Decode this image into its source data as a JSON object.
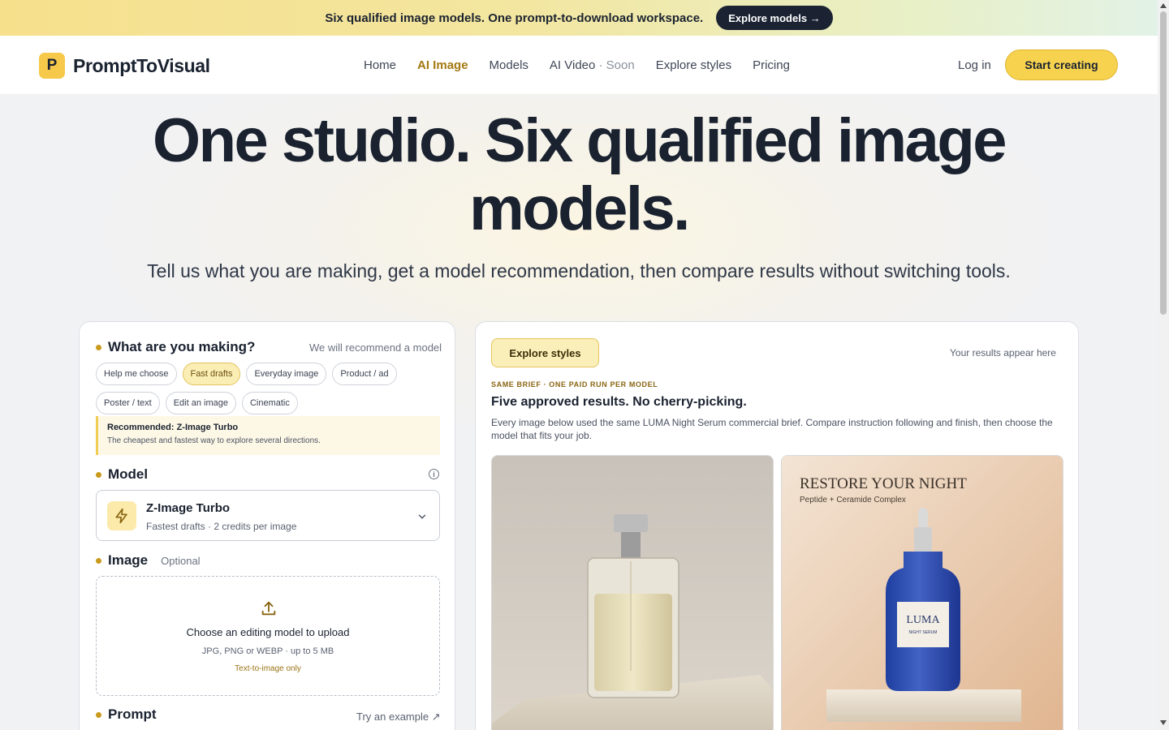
{
  "announcement": {
    "text": "Six qualified image models. One prompt-to-download workspace.",
    "cta_label": "Explore models →"
  },
  "header": {
    "logo_mark": "P",
    "logo_text": "PromptToVisual",
    "nav": [
      {
        "label": "Home",
        "active": false
      },
      {
        "label": "AI Image",
        "active": true
      },
      {
        "label": "Models",
        "active": false
      },
      {
        "label": "AI Video",
        "suffix": " · Soon",
        "active": false
      },
      {
        "label": "Explore styles",
        "active": false
      },
      {
        "label": "Pricing",
        "active": false
      }
    ],
    "login_label": "Log in",
    "start_label": "Start creating"
  },
  "hero": {
    "title": "One studio. Six qualified image models.",
    "subtitle": "Tell us what you are making, get a model recommendation, then compare results without switching tools."
  },
  "composer": {
    "making_title": "What are you making?",
    "making_aux": "We will recommend a model",
    "chips": [
      "Help me choose",
      "Fast drafts",
      "Everyday image",
      "Product / ad",
      "Poster / text",
      "Edit an image",
      "Cinematic"
    ],
    "active_chip": "Fast drafts",
    "recommendation_title": "Recommended: Z-Image Turbo",
    "recommendation_desc": "The cheapest and fastest way to explore several directions.",
    "model_title": "Model",
    "model_name": "Z-Image Turbo",
    "model_desc": "Fastest drafts · 2 credits per image",
    "image_title": "Image",
    "image_aux": "Optional",
    "drop_title": "Choose an editing model to upload",
    "drop_types": "JPG, PNG or WEBP · up to 5 MB",
    "drop_note": "Text-to-image only",
    "prompt_title": "Prompt",
    "try_example": "Try an example ↗"
  },
  "results": {
    "explore_label": "Explore styles",
    "hint": "Your results appear here",
    "kicker": "SAME BRIEF · ONE PAID RUN PER MODEL",
    "title": "Five approved results. No cherry-picking.",
    "desc": "Every image below used the same LUMA Night Serum commercial brief. Compare instruction following and finish, then choose the model that fits your job.",
    "card2_headline": "RESTORE YOUR NIGHT",
    "card2_sub": "Peptide + Ceramide Complex",
    "card2_brand": "LUMA",
    "card2_brand_sub": "NIGHT SERUM"
  },
  "colors": {
    "accent": "#f6d24f",
    "accent_text": "#a37a12",
    "dark": "#1a2230"
  },
  "icons": {
    "model": "lightning-icon",
    "upload": "upload-icon",
    "info": "info-icon",
    "chevron": "chevron-down-icon"
  }
}
